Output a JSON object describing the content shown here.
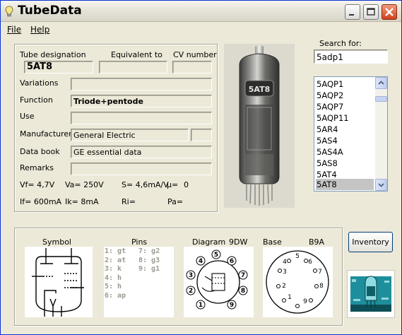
{
  "window": {
    "title": "TubeData"
  },
  "menu": {
    "file": "File",
    "help": "Help"
  },
  "search": {
    "label": "Search for:",
    "value": "5adp1"
  },
  "headers": {
    "designation": "Tube designation",
    "equivalent": "Equivalent to",
    "cv": "CV number"
  },
  "tube": {
    "designation": "5AT8",
    "equivalent": "",
    "cv": "",
    "variations": "",
    "function": "Triode+pentode",
    "use": "",
    "manufacturer": "General Electric",
    "manufacturer_extra": "",
    "databook": "GE essential data",
    "remarks": ""
  },
  "labels": {
    "variations": "Variations",
    "function": "Function",
    "use": "Use",
    "manufacturer": "Manufacturer",
    "databook": "Data book",
    "remarks": "Remarks"
  },
  "specs": {
    "vf": "Vf= 4,7V",
    "va": "Va= 250V",
    "s": "S= 4,6mA/V",
    "mu": "µ=",
    "mu_val": "0",
    "if": "If= 600mA",
    "ik": "Ik= 8mA",
    "ri": "Ri=",
    "pa": "Pa="
  },
  "photo": {
    "label": "5AT8"
  },
  "list": {
    "items": [
      "5AQP1",
      "5AQP2",
      "5AQP7",
      "5AQP11",
      "5AR4",
      "5AS4",
      "5AS4A",
      "5AS8",
      "5AT4",
      "5AT8"
    ],
    "selected": "5AT8"
  },
  "bottom": {
    "symbol": "Symbol",
    "pins": "Pins",
    "diagram": "Diagram",
    "diagram_code": "9DW",
    "base": "Base",
    "base_code": "B9A",
    "pins_col1": [
      "1: gt",
      "2: at",
      "3: k",
      "4: h",
      "5: h",
      "6: ap"
    ],
    "pins_col2": [
      "7: g2",
      "8: g3",
      "9: g1"
    ],
    "diagram_pins": [
      "1",
      "2",
      "3",
      "4",
      "5",
      "6",
      "7",
      "8",
      "9"
    ],
    "base_pins": [
      "1",
      "2",
      "3",
      "4",
      "5",
      "6",
      "7",
      "8",
      "9"
    ]
  },
  "buttons": {
    "inventory": "Inventory"
  },
  "colors": {
    "titlebar": "#e6e4da",
    "window_bg": "#ece9d8",
    "close_button": "#d2411c",
    "selected_row": "#c4c4c4",
    "logo": "#1d8f9c"
  }
}
